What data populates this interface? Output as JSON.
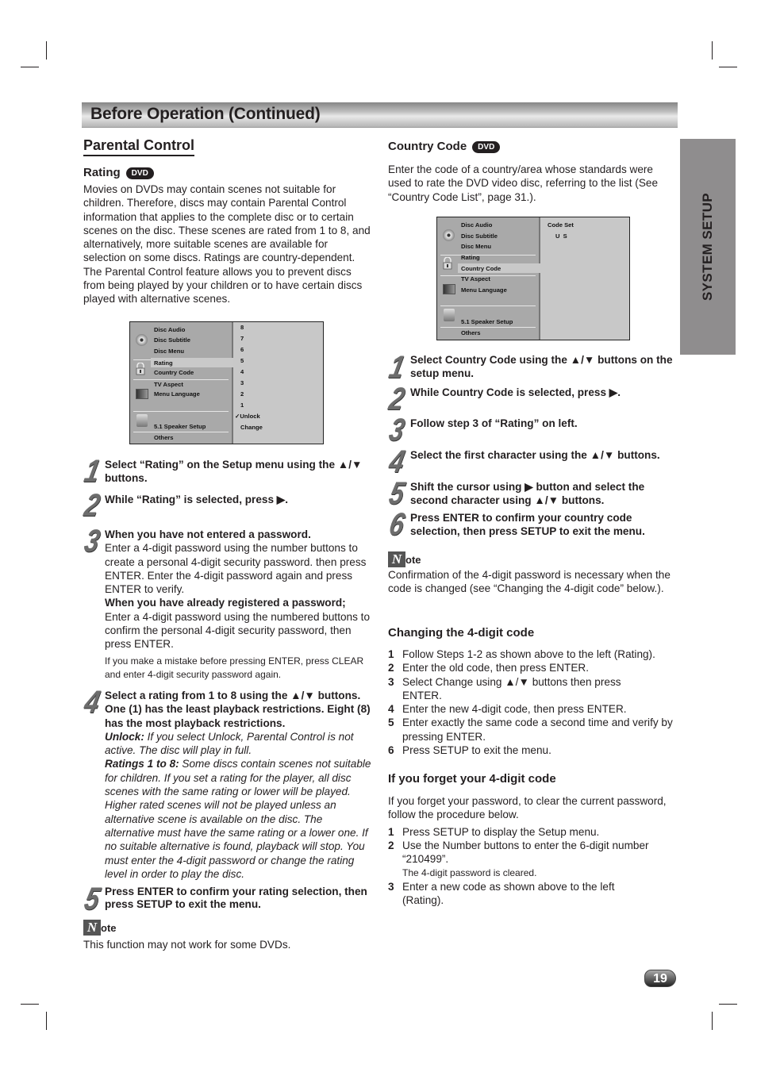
{
  "header": {
    "title": "Before Operation (Continued)"
  },
  "side_tab": {
    "label": "SYSTEM SETUP"
  },
  "left": {
    "section_title": "Parental Control",
    "rating": {
      "heading": "Rating",
      "badge": "DVD",
      "intro": "Movies on DVDs may contain scenes not suitable for children. Therefore, discs may contain Parental Control information that applies to the complete disc or to certain scenes on the disc. These scenes are rated from 1 to 8, and alternatively, more suitable scenes are available for selection on some discs. Ratings are country-dependent. The Parental Control feature allows you to prevent discs from being played by your children or to have certain discs played with alternative scenes."
    },
    "osd": {
      "menu_items": [
        "Disc Audio",
        "Disc Subtitle",
        "Disc Menu",
        "Rating",
        "Country Code",
        "TV Aspect",
        "Menu Language",
        "5.1 Speaker Setup",
        "Others"
      ],
      "selected": "Rating",
      "options": [
        "8",
        "7",
        "6",
        "5",
        "4",
        "3",
        "2",
        "1",
        "✓Unlock",
        "Change"
      ],
      "checked_option": "Unlock"
    },
    "steps": [
      {
        "num": "1",
        "bold": "Select “Rating” on the Setup menu using the ▲/▼ buttons."
      },
      {
        "num": "2",
        "bold": "While “Rating” is selected, press ▶."
      },
      {
        "num": "3",
        "bold1": "When you have not entered a password.",
        "text1": "Enter a 4-digit password using the number buttons to create a personal 4-digit security password. then press ENTER. Enter the 4-digit password again and press ENTER to verify.",
        "bold2": "When you have already registered a password;",
        "text2": "Enter a 4-digit password using the numbered buttons to confirm the personal 4-digit security password, then press ENTER.",
        "small": "If you make a mistake before pressing ENTER, press CLEAR and enter 4-digit security password again."
      },
      {
        "num": "4",
        "bold": "Select a rating from 1 to 8 using the ▲/▼ buttons. One (1) has the least playback restrictions. Eight (8) has the most playback restrictions.",
        "unlock_label": "Unlock:",
        "unlock_text": " If you select Unlock, Parental Control is not active. The disc will play in full.",
        "ratings_label": "Ratings 1 to 8:",
        "ratings_text": " Some discs contain scenes not suitable for children. If you set a rating for the player, all disc scenes with the same rating or lower will be played. Higher rated scenes will not be played unless an alternative scene is available on the disc. The alternative must have the same rating or a lower one. If no suitable alternative is found, playback will stop. You must enter the 4-digit password or change the rating level in order to play the disc."
      },
      {
        "num": "5",
        "bold": "Press ENTER to confirm your rating selection, then press SETUP to exit the menu."
      }
    ],
    "note": {
      "icon": "N",
      "word": "ote",
      "text": "This function may not work for some DVDs."
    }
  },
  "right": {
    "country_code": {
      "heading": "Country Code",
      "badge": "DVD",
      "intro": "Enter the code of a country/area whose standards were used to rate the DVD video disc, referring to the list (See “Country Code List”, page 31.)."
    },
    "osd": {
      "menu_items": [
        "Disc Audio",
        "Disc Subtitle",
        "Disc Menu",
        "Rating",
        "Country Code",
        "TV Aspect",
        "Menu Language",
        "5.1 Speaker Setup",
        "Others"
      ],
      "selected": "Country Code",
      "right_title": "Code Set",
      "right_value": "U S"
    },
    "steps": [
      {
        "num": "1",
        "text": "Select Country Code using the ▲/▼ buttons on the setup menu."
      },
      {
        "num": "2",
        "text": "While Country Code is selected, press ▶."
      },
      {
        "num": "3",
        "text": "Follow step 3 of “Rating” on left."
      },
      {
        "num": "4",
        "text": "Select the first character using the ▲/▼ buttons."
      },
      {
        "num": "5",
        "text": "Shift the cursor using ▶ button and select the second character using ▲/▼ buttons."
      },
      {
        "num": "6",
        "text": "Press ENTER to confirm your country code selection, then press SETUP to exit the menu."
      }
    ],
    "note": {
      "icon": "N",
      "word": "ote",
      "text": "Confirmation of the 4-digit password is necessary when the code is changed (see “Changing the 4-digit code” below.)."
    },
    "changing": {
      "heading": "Changing the 4-digit code",
      "items": [
        {
          "n": "1",
          "text": "Follow Steps 1-2 as shown above to the left (Rating)."
        },
        {
          "n": "2",
          "text": "Enter the old code, then press ENTER."
        },
        {
          "n": "3",
          "text": "Select Change using ▲/▼ buttons then press ENTER."
        },
        {
          "n": "4",
          "text": "Enter the new 4-digit code, then press ENTER."
        },
        {
          "n": "5",
          "text": "Enter exactly the same code a second time and verify by pressing ENTER."
        },
        {
          "n": "6",
          "text": "Press SETUP to exit the menu."
        }
      ]
    },
    "forget": {
      "heading": "If you forget your 4-digit code",
      "intro": "If you forget your password, to clear the current password, follow the procedure below.",
      "items": [
        {
          "n": "1",
          "text": "Press SETUP to display the Setup menu."
        },
        {
          "n": "2",
          "text": "Use the Number buttons to enter the 6-digit number “210499”.",
          "sub": "The 4-digit password is cleared."
        },
        {
          "n": "3",
          "text": "Enter a new code as shown above to the left (Rating)."
        }
      ]
    }
  },
  "footer": {
    "page_number": "19"
  }
}
